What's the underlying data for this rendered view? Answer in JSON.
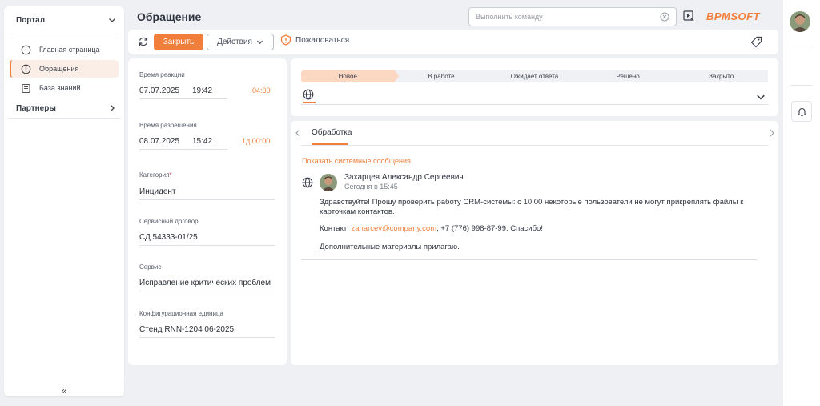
{
  "sidebar": {
    "portal_group": "Портал",
    "items": [
      {
        "label": "Главная страница",
        "icon": "dashboard-icon",
        "active": false
      },
      {
        "label": "Обращения",
        "icon": "alert-circle-icon",
        "active": true
      },
      {
        "label": "База знаний",
        "icon": "book-icon",
        "active": false
      }
    ],
    "partners_group": "Партнеры",
    "collapse_glyph": "«"
  },
  "header": {
    "title": "Обращение",
    "command_placeholder": "Выполнить команду",
    "logo_text": "BPMSOFT"
  },
  "toolbar": {
    "close_label": "Закрыть",
    "actions_label": "Действия",
    "complain_label": "Пожаловаться"
  },
  "details": {
    "reaction": {
      "label": "Время реакции",
      "date": "07.07.2025",
      "time": "19:42",
      "remaining": "04:00"
    },
    "resolution": {
      "label": "Время разрешения",
      "date": "08.07.2025",
      "time": "15:42",
      "remaining": "1д 00:00"
    },
    "category": {
      "label": "Категория",
      "required_mark": "*",
      "value": "Инцидент"
    },
    "contract": {
      "label": "Сервисный договор",
      "value": "СД 54333-01/25"
    },
    "service": {
      "label": "Сервис",
      "value": "Исправление критических проблем"
    },
    "config_unit": {
      "label": "Конфигурационная единица",
      "value": "Стенд RNN-1204 06-2025"
    }
  },
  "stages": [
    {
      "label": "Новое",
      "active": true
    },
    {
      "label": "В работе",
      "active": false
    },
    {
      "label": "Ожидает ответа",
      "active": false
    },
    {
      "label": "Решено",
      "active": false
    },
    {
      "label": "Закрыто",
      "active": false
    }
  ],
  "feed": {
    "tab_label": "Обработка",
    "show_system_messages": "Показать системные сообщения",
    "message": {
      "author": "Захарцев Александр Сергеевич",
      "time": "Сегодня в 15:45",
      "line1": "Здравствуйте! Прошу проверить работу CRM-системы: с 10:00 некоторые пользователи не могут прикреплять файлы к",
      "line2": "карточкам контактов.",
      "contact_prefix": "Контакт: ",
      "email": "zaharcev@company.com",
      "contact_suffix": ", +7 (776) 998-87-99. Спасибо!",
      "line4": "Дополнительные материалы прилагаю."
    }
  },
  "colors": {
    "accent": "#f17e3a",
    "stage_active": "#fcd7c2",
    "background": "#eef0f4"
  }
}
